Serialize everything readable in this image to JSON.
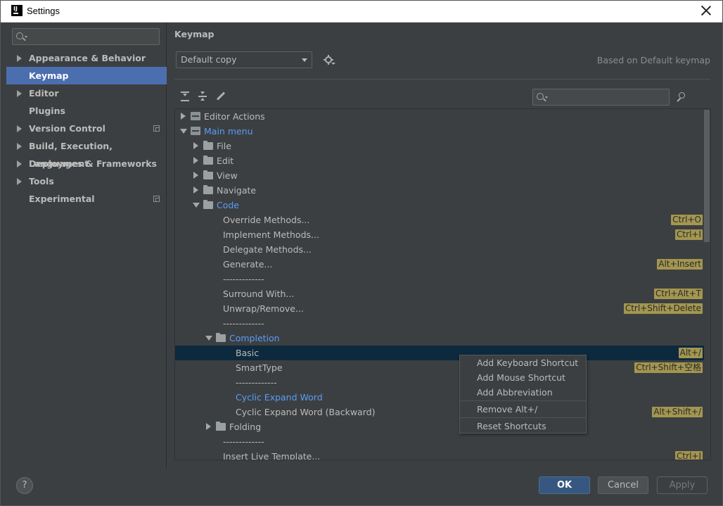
{
  "window": {
    "title": "Settings"
  },
  "sidebar": {
    "search_placeholder": "",
    "items": [
      {
        "label": "Appearance & Behavior",
        "expandable": true
      },
      {
        "label": "Keymap",
        "selected": true
      },
      {
        "label": "Editor",
        "expandable": true
      },
      {
        "label": "Plugins"
      },
      {
        "label": "Version Control",
        "expandable": true,
        "project_icon": true
      },
      {
        "label": "Build, Execution, Deployment",
        "expandable": true
      },
      {
        "label": "Languages & Frameworks",
        "expandable": true
      },
      {
        "label": "Tools",
        "expandable": true
      },
      {
        "label": "Experimental",
        "project_icon": true
      }
    ]
  },
  "main": {
    "title": "Keymap",
    "keymap_select": "Default copy",
    "based_on": "Based on Default keymap",
    "filter_placeholder": ""
  },
  "tree": {
    "rows": [
      {
        "label": "Editor Actions",
        "toggle": "collapsed",
        "icon": "action",
        "level": 0
      },
      {
        "label": "Main menu",
        "toggle": "expanded",
        "icon": "action",
        "level": 0,
        "blue": true
      },
      {
        "label": "File",
        "toggle": "collapsed",
        "icon": "folder",
        "level": 1
      },
      {
        "label": "Edit",
        "toggle": "collapsed",
        "icon": "folder",
        "level": 1
      },
      {
        "label": "View",
        "toggle": "collapsed",
        "icon": "folder",
        "level": 1
      },
      {
        "label": "Navigate",
        "toggle": "collapsed",
        "icon": "folder",
        "level": 1
      },
      {
        "label": "Code",
        "toggle": "expanded",
        "icon": "folder",
        "level": 1,
        "blue": true
      },
      {
        "label": "Override Methods...",
        "level": 2,
        "shortcut": "Ctrl+O"
      },
      {
        "label": "Implement Methods...",
        "level": 2,
        "shortcut": "Ctrl+I"
      },
      {
        "label": "Delegate Methods...",
        "level": 2
      },
      {
        "label": "Generate...",
        "level": 2,
        "shortcut": "Alt+Insert"
      },
      {
        "label": "-------------",
        "level": 2
      },
      {
        "label": "Surround With...",
        "level": 2,
        "shortcut": "Ctrl+Alt+T"
      },
      {
        "label": "Unwrap/Remove...",
        "level": 2,
        "shortcut": "Ctrl+Shift+Delete"
      },
      {
        "label": "-------------",
        "level": 2
      },
      {
        "label": "Completion",
        "toggle": "expanded",
        "icon": "folder",
        "level": 2,
        "blue": true
      },
      {
        "label": "Basic",
        "level": 3,
        "shortcut": "Alt+/",
        "selected": true
      },
      {
        "label": "SmartType",
        "level": 3,
        "shortcut": "Ctrl+Shift+空格"
      },
      {
        "label": "-------------",
        "level": 3
      },
      {
        "label": "Cyclic Expand Word",
        "level": 3,
        "blue": true
      },
      {
        "label": "Cyclic Expand Word (Backward)",
        "level": 3,
        "shortcut": "Alt+Shift+/"
      },
      {
        "label": "Folding",
        "toggle": "collapsed",
        "icon": "folder",
        "level": 2
      },
      {
        "label": "-------------",
        "level": 2
      },
      {
        "label": "Insert Live Template...",
        "level": 2,
        "shortcut": "Ctrl+J"
      }
    ]
  },
  "context_menu": {
    "group1": [
      "Add Keyboard Shortcut",
      "Add Mouse Shortcut",
      "Add Abbreviation"
    ],
    "remove": "Remove Alt+/",
    "reset": "Reset Shortcuts"
  },
  "footer": {
    "help": "?",
    "ok": "OK",
    "cancel": "Cancel",
    "apply": "Apply"
  },
  "colors": {
    "selection": "#4b6eaf",
    "tree_selection": "#0d293e",
    "link_blue": "#589df6",
    "shortcut_badge": "#a39650",
    "ok_button": "#365880"
  }
}
